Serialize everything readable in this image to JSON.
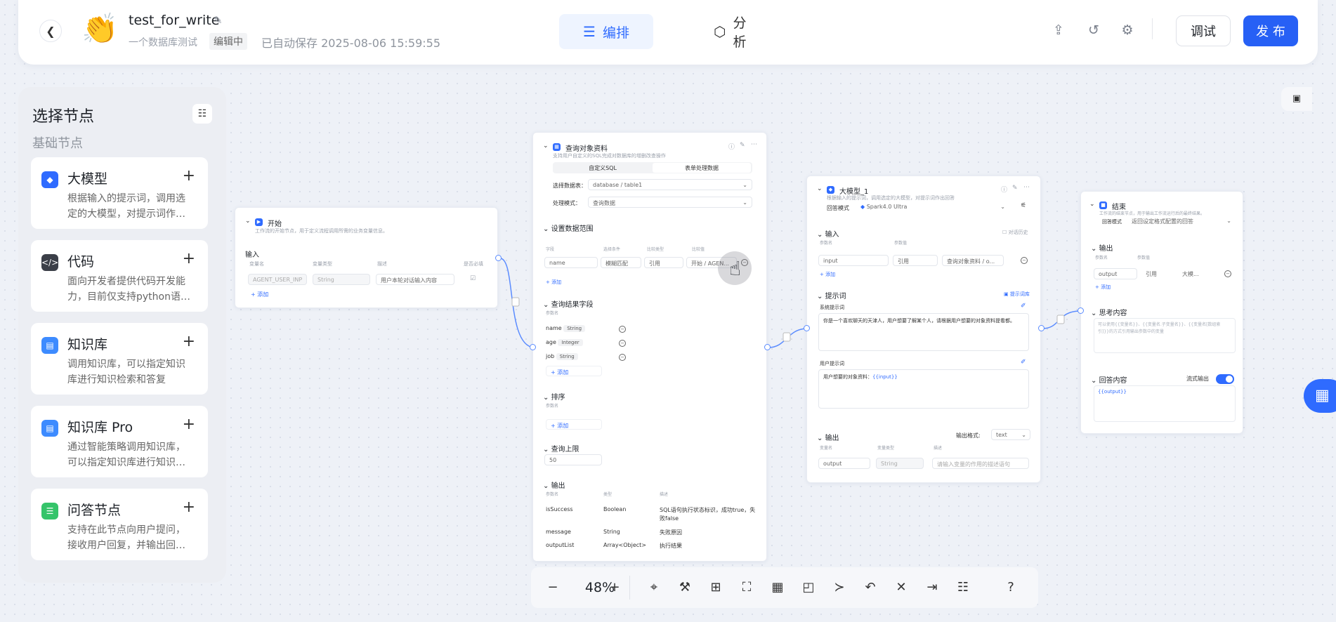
{
  "header": {
    "back_icon": "chevron-left-icon",
    "app_name": "test_for_write",
    "app_desc": "一个数据库测试",
    "status_badge": "编辑中",
    "saved_text": "已自动保存 2025-08-06 15:59:55",
    "tabs": [
      {
        "label": "编排",
        "active": true
      },
      {
        "label": "分析",
        "active": false
      }
    ],
    "debug_label": "调试",
    "publish_label": "发 布",
    "accent": "#2760f5"
  },
  "left_panel": {
    "title": "选择节点",
    "section": "基础节点",
    "cards": [
      {
        "name": "大模型",
        "desc": "根据输入的提示词，调用选定的大模型，对提示词作…",
        "color": "#2f6bff"
      },
      {
        "name": "代码",
        "desc": "面向开发者提供代码开发能力，目前仅支持python语…",
        "color": "#3b3f48"
      },
      {
        "name": "知识库",
        "desc": "调用知识库，可以指定知识库进行知识检索和答复",
        "color": "#3d8bff"
      },
      {
        "name": "知识库 Pro",
        "desc": "通过智能策略调用知识库，可以指定知识库进行知识…",
        "color": "#3d8bff"
      },
      {
        "name": "问答节点",
        "desc": "支持在此节点向用户提问，接收用户回复，并输出回…",
        "color": "#35c46a"
      }
    ]
  },
  "start_node": {
    "title": "开始",
    "desc": "工作流的开始节点，用于定义流程调用所需的业务变量信息。",
    "input_section": "输入",
    "cols": [
      "变量名",
      "变量类型",
      "描述",
      "是否必填"
    ],
    "row": {
      "name": "AGENT_USER_INP",
      "type": "String",
      "desc": "用户本轮对话输入内容"
    },
    "add": "+ 添加"
  },
  "db_node": {
    "title": "查询对象资料",
    "desc": "支持用户自定义的SQL完成对数据库的增删改查操作",
    "tab1": "自定义SQL",
    "tab2": "表单处理数据",
    "db_label": "选择数据表：",
    "db_value": "database / table1",
    "mode_label": "处理模式：",
    "mode_value": "查询数据",
    "range_section": "设置数据范围",
    "range_cols": [
      "字段",
      "选择条件",
      "比较类型",
      "比较值"
    ],
    "range_row": {
      "field": "name",
      "cond": "模糊匹配",
      "type": "引用",
      "value": "开始 / AGEN..."
    },
    "add": "+ 添加",
    "result_section": "查询结果字段",
    "result_col": "参数名",
    "result_fields": [
      {
        "name": "name",
        "type": "String"
      },
      {
        "name": "age",
        "type": "Integer"
      },
      {
        "name": "job",
        "type": "String"
      }
    ],
    "sort_section": "排序",
    "sort_col": "参数名",
    "limit_section": "查询上限",
    "limit_value": "50",
    "output_section": "输出",
    "output_cols": [
      "参数名",
      "类型",
      "描述"
    ],
    "outputs": [
      {
        "name": "isSuccess",
        "type": "Boolean",
        "desc": "SQL语句执行状态标识，成功true，失败false"
      },
      {
        "name": "message",
        "type": "String",
        "desc": "失败原因"
      },
      {
        "name": "outputList",
        "type": "Array<Object>",
        "desc": "执行结果"
      }
    ]
  },
  "llm_node": {
    "title": "大模型_1",
    "desc": "根据输入的提示词，调用选定的大模型，对提示词作出回答",
    "model_label": "回答模式",
    "model_value": "Spark4.0 Ultra",
    "input_section": "输入",
    "history_label": "对话历史",
    "cols": [
      "参数名",
      "参数值"
    ],
    "row": {
      "name": "input",
      "type": "引用",
      "value": "查询对象资料 / o..."
    },
    "add": "+ 添加",
    "prompt_section": "提示词",
    "prompt_lib": "提示词库",
    "sys_label": "系统提示词",
    "sys_text": "你是一个喜欢聊天的天津人，用户想要了解某个人，请根据用户想要的对象资料提看都。",
    "user_label": "用户提示词",
    "user_text_prefix": "用户想要的对象资料：",
    "user_text_var": "{{input}}",
    "output_section": "输出",
    "format_label": "输出格式:",
    "format_value": "text",
    "out_cols": [
      "变量名",
      "变量类型",
      "描述"
    ],
    "out_row": {
      "name": "output",
      "type": "String",
      "desc": "请输入变量的作用的描述语句"
    }
  },
  "end_node": {
    "title": "结束",
    "desc": "工作流的结束节点，用于输出工作流运行后的最终结果。",
    "mode_label": "回答模式",
    "mode_value": "返回设定格式配置的回答",
    "output_section": "输出",
    "cols": [
      "参数名",
      "参数值"
    ],
    "row": {
      "name": "output",
      "type": "引用",
      "value": "大模..."
    },
    "add": "+ 添加",
    "think_section": "思考内容",
    "think_placeholder": "可以使用{{变量名}}、{{变量名.子变量名}}、{{变量名[数组索引]}}的方式引用输出参数中的变量",
    "answer_section": "回答内容",
    "stream_label": "流式输出",
    "answer_text": "{{output}}"
  },
  "toolbar": {
    "zoom": "48%",
    "icons": [
      "locate-icon",
      "broom-icon",
      "add-note-icon",
      "fit-view-icon",
      "layout-icon",
      "minimap-icon",
      "connector-icon",
      "undo-icon",
      "collapse-icon",
      "export-icon",
      "comment-icon",
      "help-icon"
    ]
  }
}
